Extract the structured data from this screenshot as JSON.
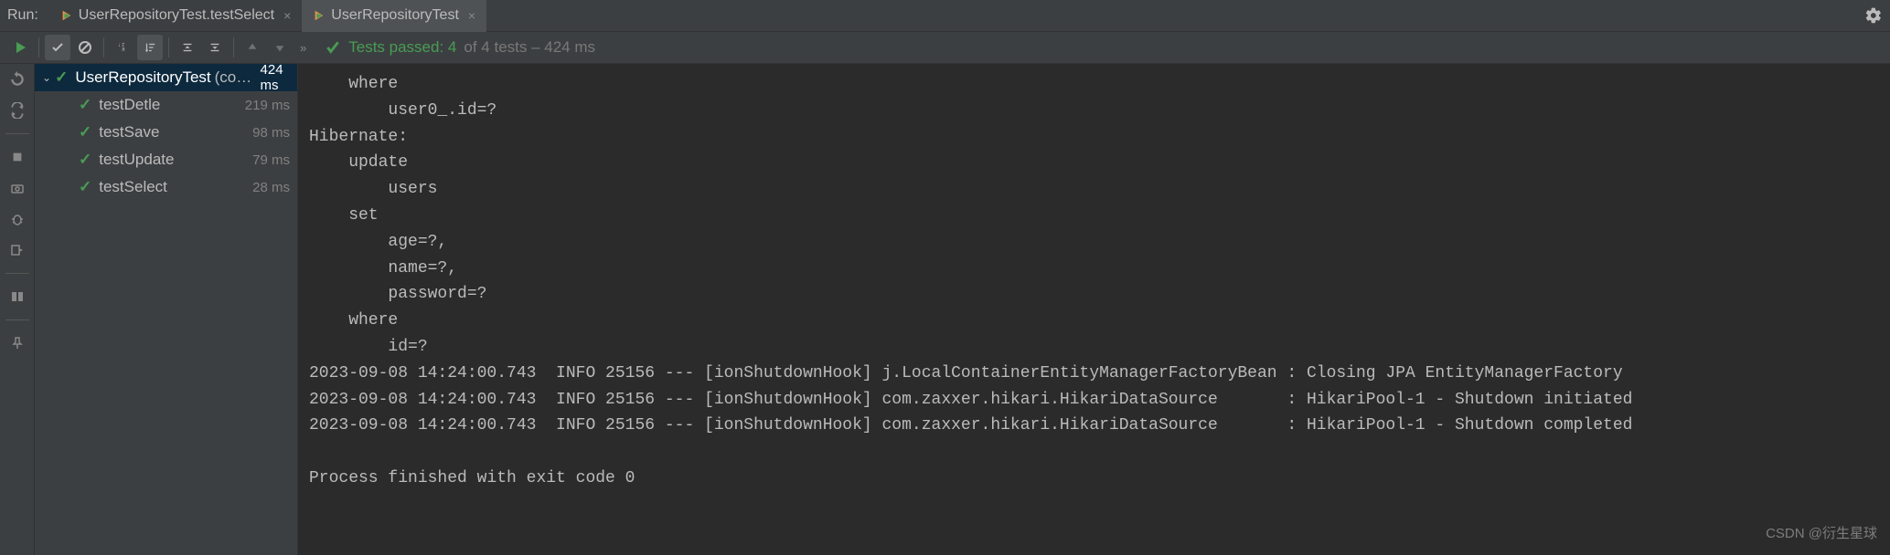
{
  "header": {
    "run_label": "Run:",
    "tabs": [
      {
        "label": "UserRepositoryTest.testSelect"
      },
      {
        "label": "UserRepositoryTest"
      }
    ]
  },
  "toolbar": {
    "status_label": "Tests passed:",
    "passed_count": "4",
    "total_suffix": "of 4 tests – 424 ms"
  },
  "tree": {
    "root": {
      "name": "UserRepositoryTest",
      "pkg": "(com.exar",
      "time": "424 ms"
    },
    "children": [
      {
        "name": "testDetle",
        "time": "219 ms"
      },
      {
        "name": "testSave",
        "time": "98 ms"
      },
      {
        "name": "testUpdate",
        "time": "79 ms"
      },
      {
        "name": "testSelect",
        "time": "28 ms"
      }
    ]
  },
  "console": "    where\n        user0_.id=?\nHibernate: \n    update\n        users \n    set\n        age=?,\n        name=?,\n        password=? \n    where\n        id=?\n2023-09-08 14:24:00.743  INFO 25156 --- [ionShutdownHook] j.LocalContainerEntityManagerFactoryBean : Closing JPA EntityManagerFactory \n2023-09-08 14:24:00.743  INFO 25156 --- [ionShutdownHook] com.zaxxer.hikari.HikariDataSource       : HikariPool-1 - Shutdown initiated\n2023-09-08 14:24:00.743  INFO 25156 --- [ionShutdownHook] com.zaxxer.hikari.HikariDataSource       : HikariPool-1 - Shutdown completed\n\nProcess finished with exit code 0",
  "watermark": "CSDN @衍生星球"
}
